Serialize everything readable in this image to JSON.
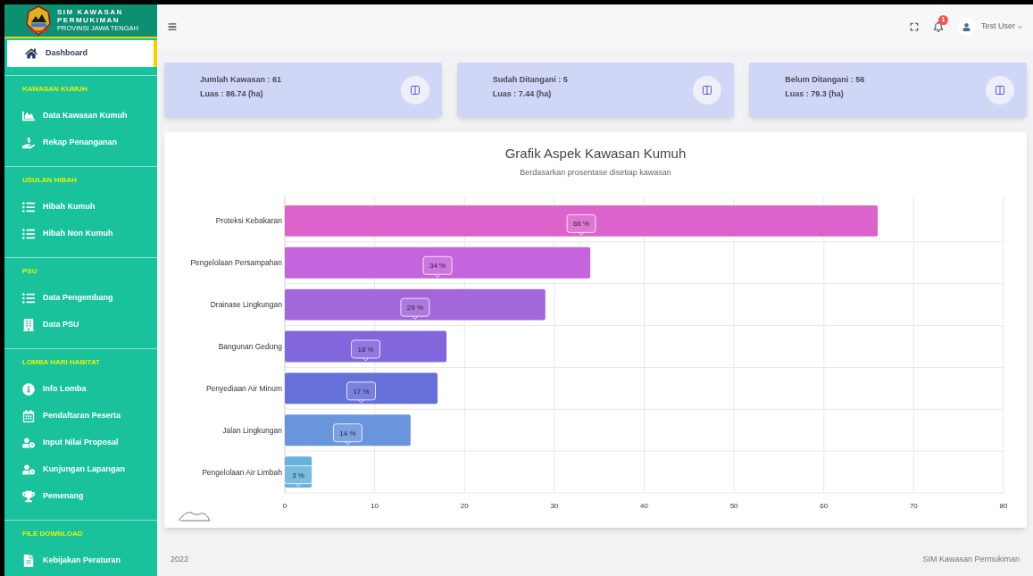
{
  "brand": {
    "title": "SIM KAWASAN",
    "subtitle": "PERMUKIMAN",
    "region": "PROVINSI JAWA TENGAH"
  },
  "sidebar": {
    "top_item": {
      "label": "Dashboard",
      "selected": true
    },
    "sections": [
      {
        "title": "KAWASAN KUMUH",
        "items": [
          {
            "label": "Data Kawasan Kumuh",
            "selected": false
          },
          {
            "label": "Rekap Penanganan",
            "selected": false
          }
        ]
      },
      {
        "title": "USULAN HIBAH",
        "items": [
          {
            "label": "Hibah Kumuh",
            "selected": false
          },
          {
            "label": "Hibah Non Kumuh",
            "selected": false
          }
        ]
      },
      {
        "title": "PSU",
        "items": [
          {
            "label": "Data Pengembang",
            "selected": false
          },
          {
            "label": "Data PSU",
            "selected": false
          }
        ]
      },
      {
        "title": "LOMBA HARI HABITAT",
        "items": [
          {
            "label": "Info Lomba",
            "selected": false
          },
          {
            "label": "Pendaftaran Peserta",
            "selected": false
          },
          {
            "label": "Input Nilai Proposal",
            "selected": false
          },
          {
            "label": "Kunjungan Lapangan",
            "selected": false
          },
          {
            "label": "Pemenang",
            "selected": false
          }
        ]
      },
      {
        "title": "FILE DOWNLOAD",
        "items": [
          {
            "label": "Kebijakan Peraturan",
            "selected": false
          }
        ]
      }
    ]
  },
  "topbar": {
    "notification_count": "1",
    "user_name": "Test User"
  },
  "stat_cards": [
    {
      "line_1": "Jumlah Kawasan : 61",
      "line_2": "Luas : 86.74 (ha)"
    },
    {
      "line_1": "Sudah Ditangani : 5",
      "line_2": "Luas : 7.44 (ha)"
    },
    {
      "line_1": "Belum Ditangani : 56",
      "line_2": "Luas : 79.3 (ha)"
    }
  ],
  "chart": {
    "chart_data": {
      "type": "bar",
      "orientation": "horizontal",
      "title": "Grafik Aspek Kawasan Kumuh",
      "subtitle": "Berdasarkan prosentase disetiap kawasan",
      "categories": [
        "Proteksi Kebakaran",
        "Pengelolaan Persampahan",
        "Drainase Lingkungan",
        "Bangunan Gedung",
        "Penyediaan Air Minum",
        "Jalan Lingkungan",
        "Pengelolaan Air Limbah"
      ],
      "series": [
        {
          "values": [
            66,
            34,
            29,
            18,
            17,
            14,
            3
          ]
        }
      ],
      "value_labels": [
        "66 %",
        "34 %",
        "29 %",
        "18 %",
        "17 %",
        "14 %",
        "3 %"
      ],
      "grid": true,
      "xlim": [
        0,
        80
      ],
      "xticks": [
        0,
        10,
        20,
        30,
        40,
        50,
        60,
        70,
        80
      ]
    }
  },
  "footer": {
    "year": "2022",
    "app_name": "SIM Kawasan Permukiman"
  }
}
